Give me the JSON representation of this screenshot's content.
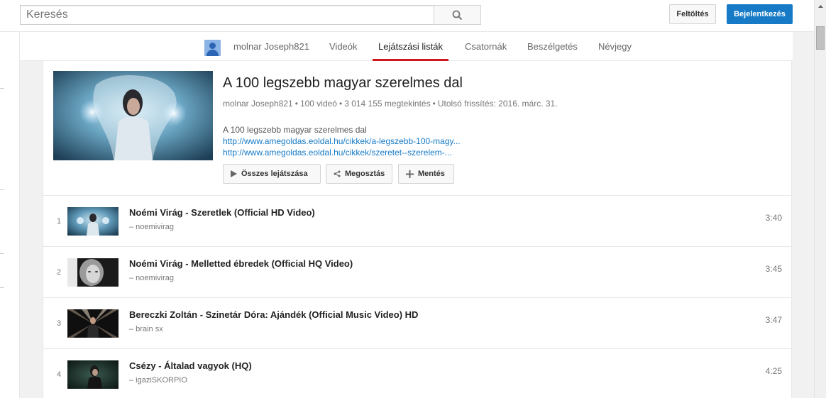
{
  "masthead": {
    "search_placeholder": "Keresés",
    "upload_label": "Feltöltés",
    "signin_label": "Bejelentkezés"
  },
  "channel_nav": {
    "channel_name": "molnar Joseph821",
    "tabs": [
      {
        "label": "Videók"
      },
      {
        "label": "Lejátszási listák"
      },
      {
        "label": "Csatornák"
      },
      {
        "label": "Beszélgetés"
      },
      {
        "label": "Névjegy"
      }
    ],
    "active_tab": "Lejátszási listák"
  },
  "playlist": {
    "title": "A 100 legszebb magyar szerelmes dal",
    "meta": {
      "owner": "molnar Joseph821",
      "video_count": "100 videó",
      "views": "3 014 155 megtekintés",
      "updated": "Utolsó frissítés: 2016. márc. 31."
    },
    "description": "A 100 legszebb magyar szerelmes dal",
    "links": [
      "http://www.amegoldas.eoldal.hu/cikkek/a-legszebb-100-magy...",
      "http://www.amegoldas.eoldal.hu/cikkek/szeretet--szerelem-..."
    ],
    "buttons": {
      "play_all": "Összes lejátszása",
      "share": "Megosztás",
      "save": "Mentés"
    }
  },
  "videos": [
    {
      "index": "1",
      "title": "Noémi Virág - Szeretlek (Official HD Video)",
      "channel": "– noemivirag",
      "duration": "3:40"
    },
    {
      "index": "2",
      "title": "Noémi Virág - Melletted ébredek (Official HQ Video)",
      "channel": "– noemivirag",
      "duration": "3:45"
    },
    {
      "index": "3",
      "title": "Bereczki Zoltán - Szinetár Dóra: Ajándék (Official Music Video) HD",
      "channel": "– brain sx",
      "duration": "3:47"
    },
    {
      "index": "4",
      "title": "Csézy - Általad vagyok (HQ)",
      "channel": "– igaziSKORPIO",
      "duration": "4:25"
    }
  ],
  "colors": {
    "accent_red": "#cc181e",
    "signin_blue": "#167ac6",
    "link_blue": "#167ac6"
  }
}
